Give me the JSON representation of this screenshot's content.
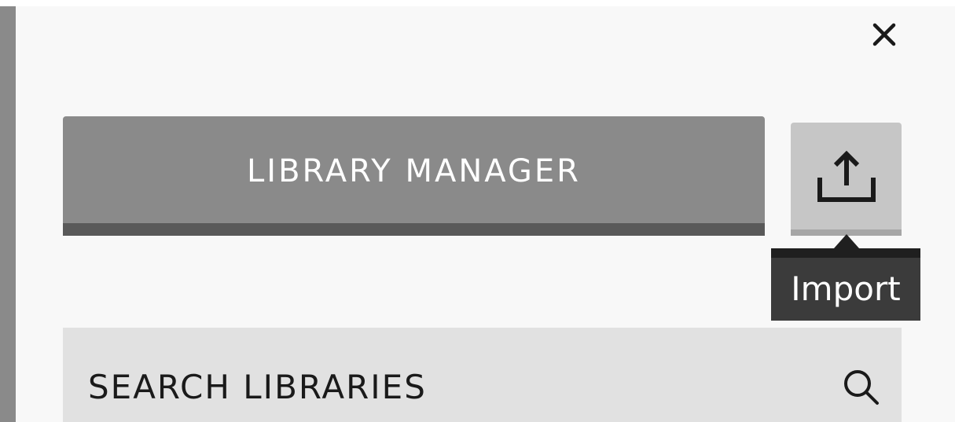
{
  "dialog": {
    "close_icon": "close-icon",
    "library_manager_label": "LIBRARY MANAGER",
    "import_icon": "upload-icon",
    "import_tooltip": "Import",
    "search": {
      "placeholder": "SEARCH LIBRARIES",
      "value": "",
      "icon": "search-icon"
    }
  },
  "colors": {
    "panel_bg": "#f8f8f8",
    "primary_button": "#8a8a8a",
    "primary_button_underline": "#595959",
    "secondary_button": "#c6c6c6",
    "tooltip_bg": "#3b3b3b",
    "search_bg": "#e1e1e1"
  }
}
